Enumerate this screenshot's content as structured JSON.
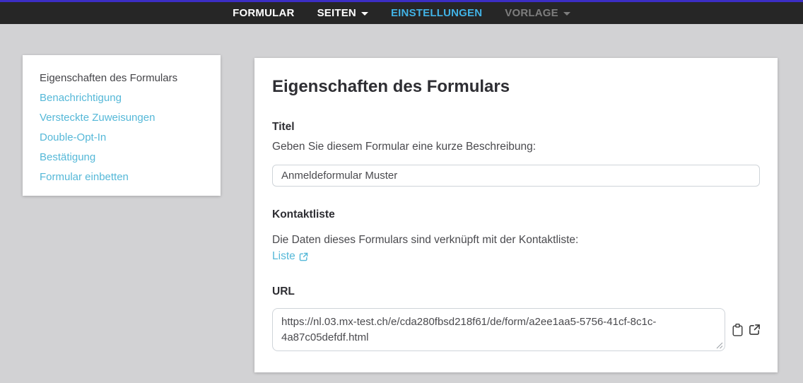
{
  "nav": {
    "items": [
      {
        "label": "FORMULAR",
        "state": "default",
        "caret": false
      },
      {
        "label": "SEITEN",
        "state": "default",
        "caret": true
      },
      {
        "label": "EINSTELLUNGEN",
        "state": "active",
        "caret": false
      },
      {
        "label": "VORLAGE",
        "state": "disabled",
        "caret": true
      }
    ]
  },
  "sidebar": {
    "items": [
      {
        "label": "Eigenschaften des Formulars",
        "active": true
      },
      {
        "label": "Benachrichtigung",
        "active": false
      },
      {
        "label": "Versteckte Zuweisungen",
        "active": false
      },
      {
        "label": "Double-Opt-In",
        "active": false
      },
      {
        "label": "Bestätigung",
        "active": false
      },
      {
        "label": "Formular einbetten",
        "active": false
      }
    ]
  },
  "main": {
    "title": "Eigenschaften des Formulars",
    "titel": {
      "label": "Titel",
      "description": "Geben Sie diesem Formular eine kurze Beschreibung:",
      "value": "Anmeldeformular Muster"
    },
    "kontaktliste": {
      "label": "Kontaktliste",
      "description": "Die Daten dieses Formulars sind verknüpft mit der Kontaktliste:",
      "link_label": "Liste"
    },
    "url": {
      "label": "URL",
      "value": "https://nl.03.mx-test.ch/e/cda280fbsd218f61/de/form/a2ee1aa5-5756-41cf-8c1c-4a87c05defdf.html"
    }
  },
  "icons": {
    "nav_caret": "caret-down-icon",
    "liste_external": "external-link-icon",
    "copy": "clipboard-icon",
    "open_url": "external-link-icon"
  },
  "colors": {
    "top_strip": "#3c2ec4",
    "navbar_bg": "#262626",
    "nav_active_blue": "#41b2e5",
    "nav_disabled_gray": "#7d7d7d",
    "link_blue": "#55b8d8",
    "page_bg": "#d2d2d4",
    "card_bg": "#ffffff",
    "text_dark": "#2e2e33",
    "text_body": "#4a4a4e"
  }
}
